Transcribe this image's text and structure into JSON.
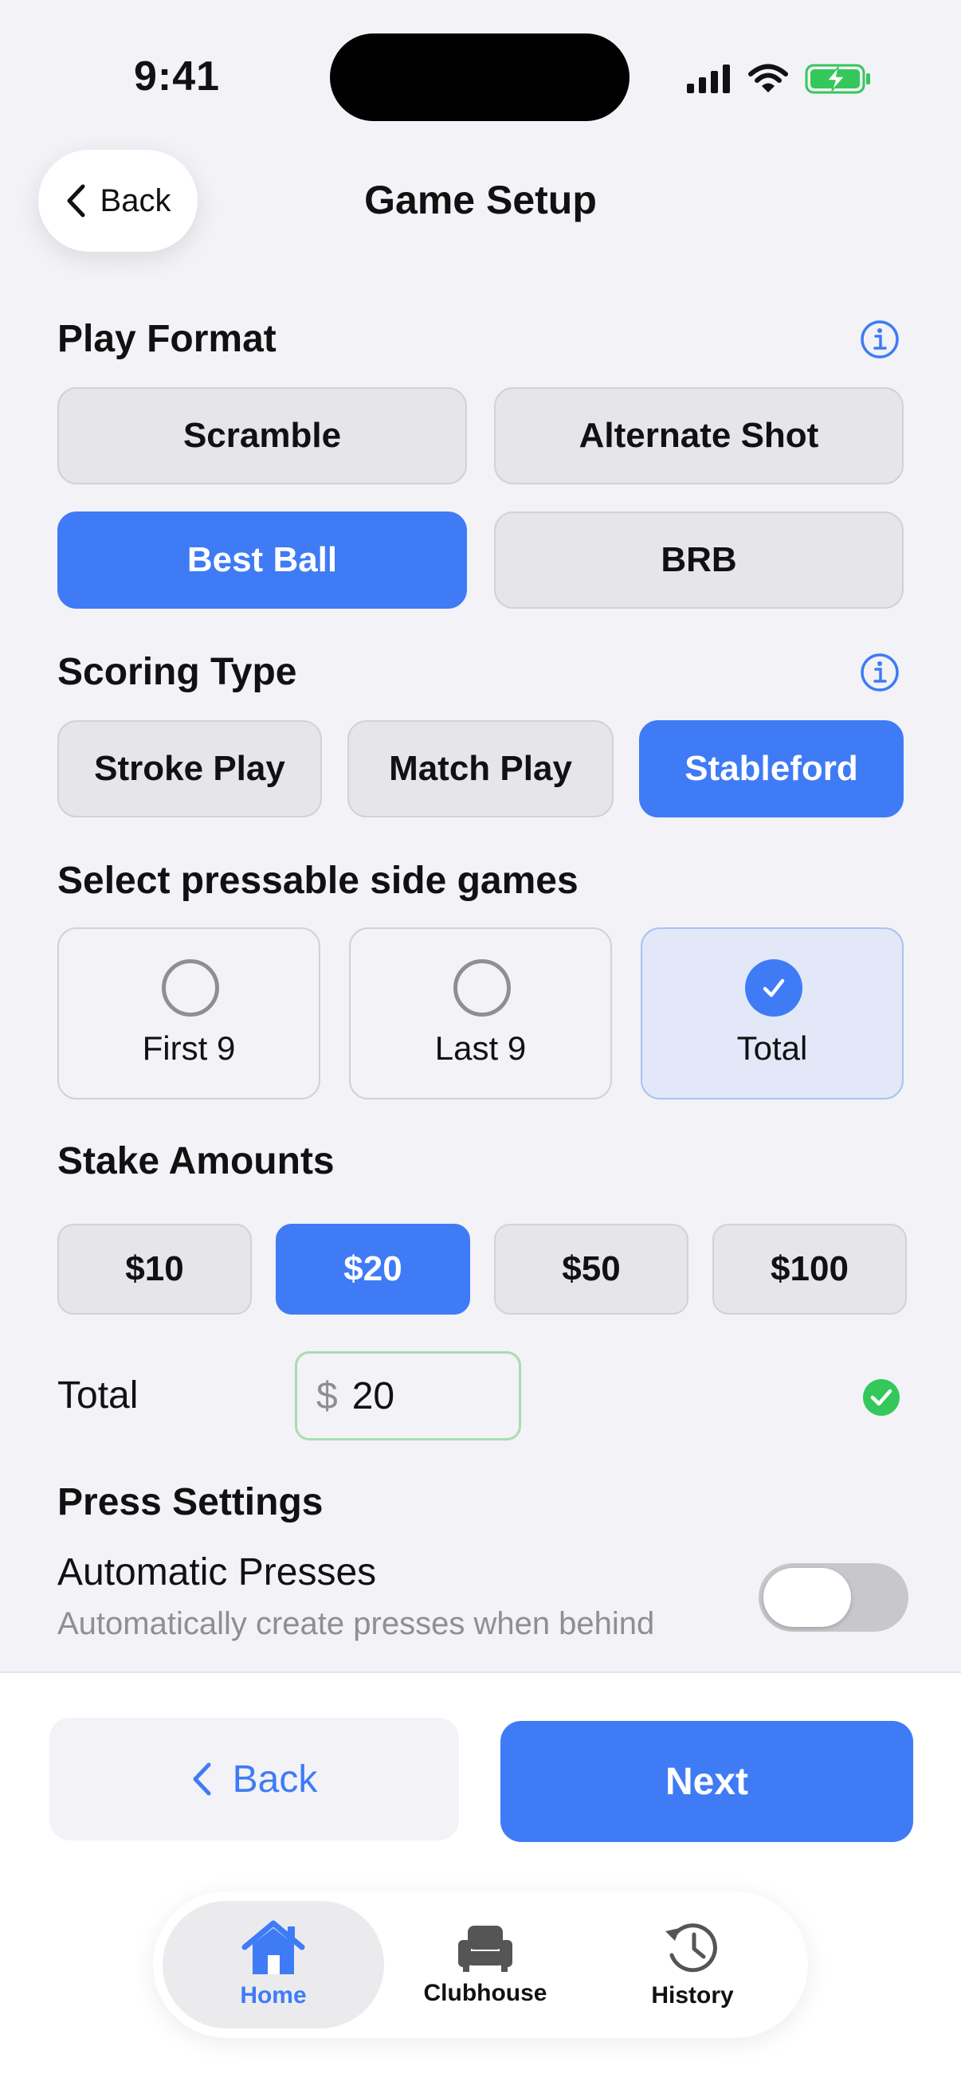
{
  "status_bar": {
    "time": "9:41",
    "icons": [
      "signal-icon",
      "wifi-icon",
      "battery-charging-icon"
    ],
    "battery_color": "#34C759"
  },
  "header": {
    "back_label": "Back",
    "title": "Game Setup"
  },
  "play_format": {
    "title": "Play Format",
    "options": [
      "Scramble",
      "Alternate Shot",
      "Best Ball",
      "BRB"
    ],
    "selected": "Best Ball"
  },
  "scoring_type": {
    "title": "Scoring Type",
    "options": [
      "Stroke Play",
      "Match Play",
      "Stableford"
    ],
    "selected": "Stableford"
  },
  "side_games": {
    "title": "Select pressable side games",
    "options": [
      {
        "label": "First 9",
        "checked": false
      },
      {
        "label": "Last 9",
        "checked": false
      },
      {
        "label": "Total",
        "checked": true
      }
    ]
  },
  "stakes": {
    "title": "Stake Amounts",
    "options": [
      "$10",
      "$20",
      "$50",
      "$100"
    ],
    "selected": "$20"
  },
  "total": {
    "label": "Total",
    "currency": "$",
    "value": "20",
    "valid": true
  },
  "press_settings": {
    "title": "Press Settings",
    "auto_title": "Automatic Presses",
    "auto_subtitle": "Automatically create presses when behind",
    "auto_enabled": false
  },
  "footer": {
    "back_label": "Back",
    "next_label": "Next"
  },
  "tabbar": {
    "tabs": [
      {
        "label": "Home",
        "icon": "home-icon",
        "active": true
      },
      {
        "label": "Clubhouse",
        "icon": "armchair-icon",
        "active": false
      },
      {
        "label": "History",
        "icon": "history-icon",
        "active": false
      }
    ]
  },
  "colors": {
    "accent": "#3F7BF5",
    "background": "#F2F2F7",
    "success": "#34C759"
  }
}
